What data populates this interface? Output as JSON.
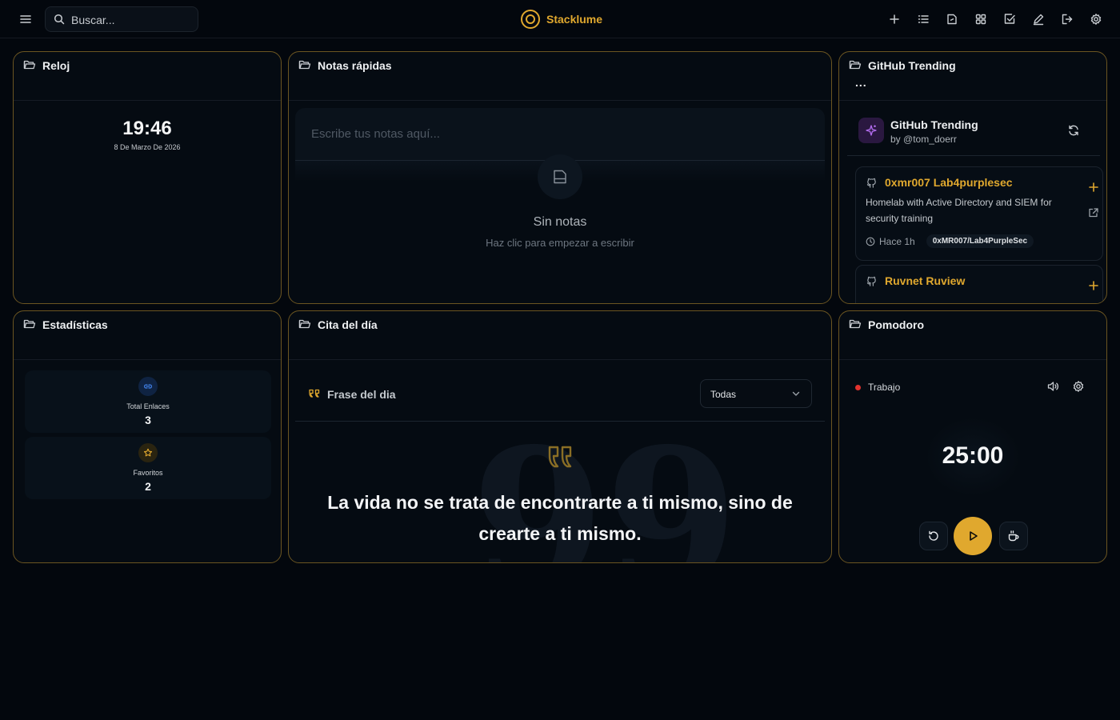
{
  "app": {
    "name": "Stacklume"
  },
  "search": {
    "placeholder": "Buscar..."
  },
  "toolbar": {
    "icons": [
      "plus-icon",
      "list-icon",
      "note-icon",
      "grid-icon",
      "checkbox-icon",
      "pen-icon",
      "logout-icon",
      "settings-icon"
    ]
  },
  "colors": {
    "accent": "#e0a82e",
    "background": "#03070d",
    "card_border": "#6b5521"
  },
  "clock": {
    "title": "Reloj",
    "time": "19:46",
    "date": "8 De Marzo De 2026"
  },
  "notes": {
    "title": "Notas rápidas",
    "placeholder": "Escribe tus notas aquí...",
    "empty_title": "Sin notas",
    "empty_subtitle": "Haz clic para empezar a escribir"
  },
  "github": {
    "title": "GitHub Trending",
    "more": "...",
    "widget_name": "GitHub Trending",
    "author": "by @tom_doerr",
    "repos": [
      {
        "name": "0xmr007 Lab4purplesec",
        "description": "Homelab with Active Directory and SIEM for security training",
        "time": "Hace 1h",
        "tag": "0xMR007/Lab4PurpleSec"
      },
      {
        "name": "Ruvnet Ruview"
      }
    ]
  },
  "stats": {
    "title": "Estadísticas",
    "items": [
      {
        "label": "Total Enlaces",
        "value": "3"
      },
      {
        "label": "Favoritos",
        "value": "2"
      }
    ]
  },
  "quote": {
    "title": "Cita del día",
    "header_label": "Frase del dia",
    "filter": "Todas",
    "text": "La vida no se trata de encontrarte a ti mismo, sino de crearte a ti mismo."
  },
  "pomodoro": {
    "title": "Pomodoro",
    "state": "Trabajo",
    "time": "25:00"
  }
}
